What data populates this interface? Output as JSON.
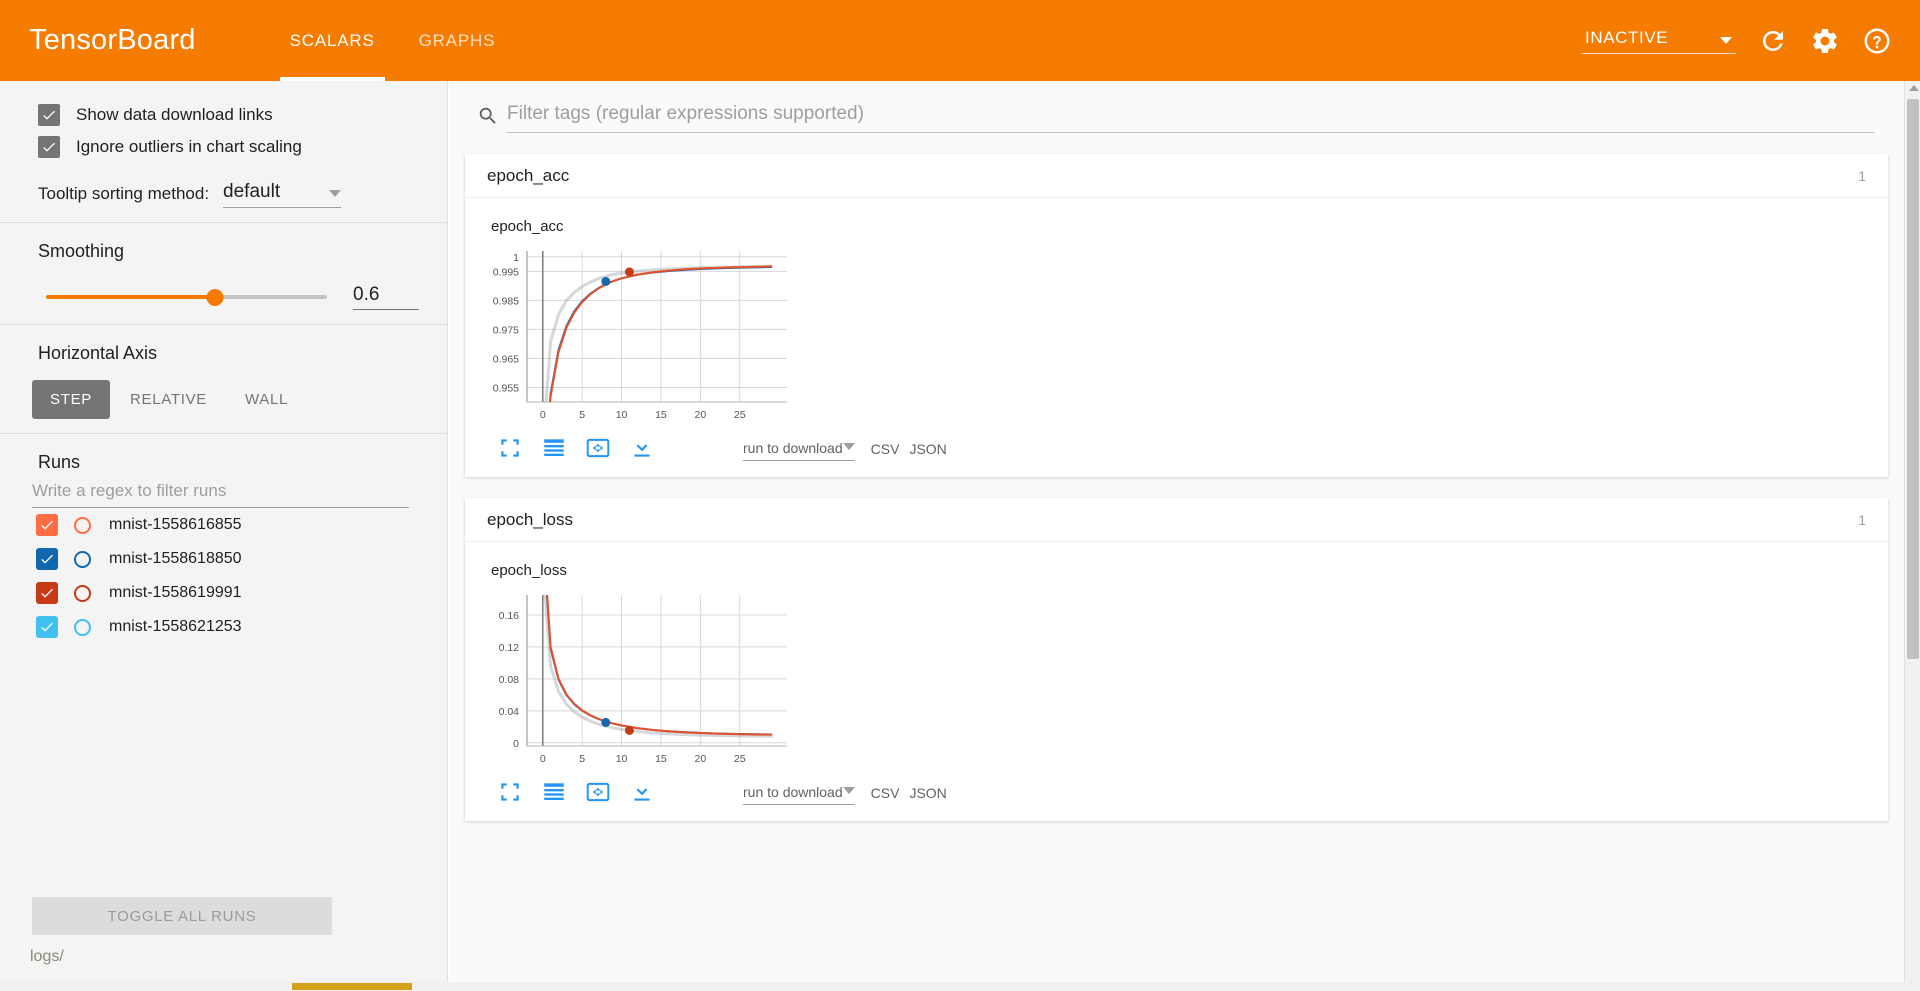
{
  "app": {
    "brand": "TensorBoard",
    "tabs": [
      {
        "label": "SCALARS",
        "active": true
      },
      {
        "label": "GRAPHS",
        "active": false
      }
    ],
    "status": "INACTIVE",
    "icons": {
      "reload": "refresh-icon",
      "settings": "gear-icon",
      "help": "help-icon"
    },
    "accent_color": "#f57c00"
  },
  "sidebar": {
    "checkboxes": [
      {
        "label": "Show data download links",
        "checked": true
      },
      {
        "label": "Ignore outliers in chart scaling",
        "checked": true
      }
    ],
    "tooltip_sorting": {
      "label": "Tooltip sorting method:",
      "value": "default"
    },
    "smoothing": {
      "title": "Smoothing",
      "value": "0.6",
      "fraction": 0.6
    },
    "horizontal_axis": {
      "title": "Horizontal Axis",
      "options": [
        {
          "label": "STEP",
          "active": true
        },
        {
          "label": "RELATIVE",
          "active": false
        },
        {
          "label": "WALL",
          "active": false
        }
      ]
    },
    "runs": {
      "title": "Runs",
      "filter_placeholder": "Write a regex to filter runs",
      "items": [
        {
          "name": "mnist-1558616855",
          "color": "#ff6d42",
          "checked": true
        },
        {
          "name": "mnist-1558618850",
          "color": "#1268ae",
          "checked": true
        },
        {
          "name": "mnist-1558619991",
          "color": "#c63a18",
          "checked": true
        },
        {
          "name": "mnist-1558621253",
          "color": "#41c0f0",
          "checked": true
        }
      ],
      "toggle_all_label": "TOGGLE ALL RUNS"
    },
    "logs_path": "logs/"
  },
  "main": {
    "filter_placeholder": "Filter tags (regular expressions supported)",
    "cards": [
      {
        "header": "epoch_acc",
        "count": "1",
        "toolbar": {
          "icons": [
            "fullscreen-icon",
            "data-table-icon",
            "fit-domain-icon",
            "download-icon"
          ],
          "run_to_download": "run to download",
          "csv": "CSV",
          "json": "JSON"
        }
      },
      {
        "header": "epoch_loss",
        "count": "1",
        "toolbar": {
          "icons": [
            "fullscreen-icon",
            "data-table-icon",
            "fit-domain-icon",
            "download-icon"
          ],
          "run_to_download": "run to download",
          "csv": "CSV",
          "json": "JSON"
        }
      }
    ]
  },
  "chart_data": [
    {
      "type": "line",
      "title": "epoch_acc",
      "xlabel": "",
      "ylabel": "",
      "xlim": [
        -2,
        31
      ],
      "ylim": [
        0.95,
        1.002
      ],
      "xticks": [
        0,
        5,
        10,
        15,
        20,
        25
      ],
      "yticks": [
        0.955,
        0.965,
        0.975,
        0.985,
        0.995,
        1
      ],
      "ytick_labels": [
        "0.955",
        "0.965",
        "0.975",
        "0.985",
        "0.995",
        "1"
      ],
      "grid": true,
      "legend": "none",
      "x": [
        0,
        1,
        2,
        3,
        4,
        5,
        6,
        7,
        8,
        9,
        10,
        12,
        14,
        16,
        18,
        20,
        22,
        24,
        26,
        28,
        29
      ],
      "series": [
        {
          "name": "mnist-1558616855",
          "color": "#ff6d42",
          "style": "raw",
          "values": [
            0.9351,
            0.9712,
            0.9803,
            0.9851,
            0.9878,
            0.9898,
            0.9912,
            0.9925,
            0.9933,
            0.9939,
            0.9944,
            0.995,
            0.9954,
            0.9957,
            0.996,
            0.9962,
            0.9964,
            0.9965,
            0.9966,
            0.9967,
            0.9968
          ]
        },
        {
          "name": "mnist-1558618850",
          "color": "#1268ae",
          "style": "smoothed",
          "values": [
            0.9189,
            0.9529,
            0.9679,
            0.9761,
            0.9812,
            0.9847,
            0.9872,
            0.9891,
            0.9906,
            0.9917,
            0.9926,
            0.9938,
            0.9946,
            0.9951,
            0.9955,
            0.9958,
            0.996,
            0.9962,
            0.9963,
            0.9964,
            0.9965
          ]
        },
        {
          "name": "mnist-1558619991",
          "color": "#e8502a",
          "style": "smoothed",
          "values": [
            0.9178,
            0.952,
            0.9672,
            0.9756,
            0.9808,
            0.9844,
            0.987,
            0.989,
            0.9905,
            0.9917,
            0.9926,
            0.9939,
            0.9947,
            0.9953,
            0.9957,
            0.996,
            0.9962,
            0.9964,
            0.9965,
            0.9966,
            0.9967
          ]
        },
        {
          "name": "mnist-1558621253",
          "color": "#41c0f0",
          "style": "raw",
          "values": [
            0.9338,
            0.9705,
            0.9799,
            0.9848,
            0.9876,
            0.9897,
            0.9912,
            0.9924,
            0.9933,
            0.994,
            0.9945,
            0.9952,
            0.9956,
            0.9959,
            0.9961,
            0.9963,
            0.9964,
            0.9965,
            0.9966,
            0.9967,
            0.9967
          ]
        }
      ],
      "markers": [
        {
          "x": 8,
          "y": 0.9915,
          "color": "#1268ae"
        },
        {
          "x": 11,
          "y": 0.9948,
          "color": "#c63a18"
        }
      ]
    },
    {
      "type": "line",
      "title": "epoch_loss",
      "xlabel": "",
      "ylabel": "",
      "xlim": [
        -2,
        31
      ],
      "ylim": [
        -0.004,
        0.185
      ],
      "xticks": [
        0,
        5,
        10,
        15,
        20,
        25
      ],
      "yticks": [
        0,
        0.04,
        0.08,
        0.12,
        0.16
      ],
      "ytick_labels": [
        "0",
        "0.04",
        "0.08",
        "0.12",
        "0.16"
      ],
      "grid": true,
      "legend": "none",
      "x": [
        0,
        1,
        2,
        3,
        4,
        5,
        6,
        7,
        8,
        9,
        10,
        12,
        14,
        16,
        18,
        20,
        22,
        24,
        26,
        28,
        29
      ],
      "series": [
        {
          "name": "mnist-1558616855",
          "color": "#ff6d42",
          "style": "raw",
          "values": [
            0.22,
            0.095,
            0.064,
            0.048,
            0.0385,
            0.032,
            0.0272,
            0.0236,
            0.0208,
            0.0186,
            0.0168,
            0.0142,
            0.0124,
            0.0112,
            0.0102,
            0.0096,
            0.0091,
            0.0088,
            0.0085,
            0.0083,
            0.0082
          ]
        },
        {
          "name": "mnist-1558618850",
          "color": "#1268ae",
          "style": "smoothed",
          "values": [
            0.26,
            0.118,
            0.079,
            0.06,
            0.0482,
            0.0402,
            0.0344,
            0.03,
            0.0266,
            0.0239,
            0.0217,
            0.0184,
            0.0161,
            0.0145,
            0.0133,
            0.0124,
            0.0117,
            0.0112,
            0.0108,
            0.0105,
            0.0104
          ]
        },
        {
          "name": "mnist-1558619991",
          "color": "#e8502a",
          "style": "smoothed",
          "values": [
            0.264,
            0.12,
            0.08,
            0.0606,
            0.0487,
            0.0406,
            0.0347,
            0.0302,
            0.0267,
            0.024,
            0.0218,
            0.0184,
            0.016,
            0.0143,
            0.0131,
            0.0122,
            0.0115,
            0.011,
            0.0106,
            0.0103,
            0.0102
          ]
        },
        {
          "name": "mnist-1558621253",
          "color": "#41c0f0",
          "style": "raw",
          "values": [
            0.223,
            0.096,
            0.0648,
            0.0486,
            0.039,
            0.0324,
            0.0275,
            0.0238,
            0.021,
            0.0188,
            0.017,
            0.0143,
            0.0125,
            0.0112,
            0.0103,
            0.0096,
            0.0091,
            0.0088,
            0.0085,
            0.0083,
            0.0082
          ]
        }
      ],
      "markers": [
        {
          "x": 8,
          "y": 0.0255,
          "color": "#1268ae"
        },
        {
          "x": 11,
          "y": 0.0155,
          "color": "#c63a18"
        }
      ]
    }
  ]
}
